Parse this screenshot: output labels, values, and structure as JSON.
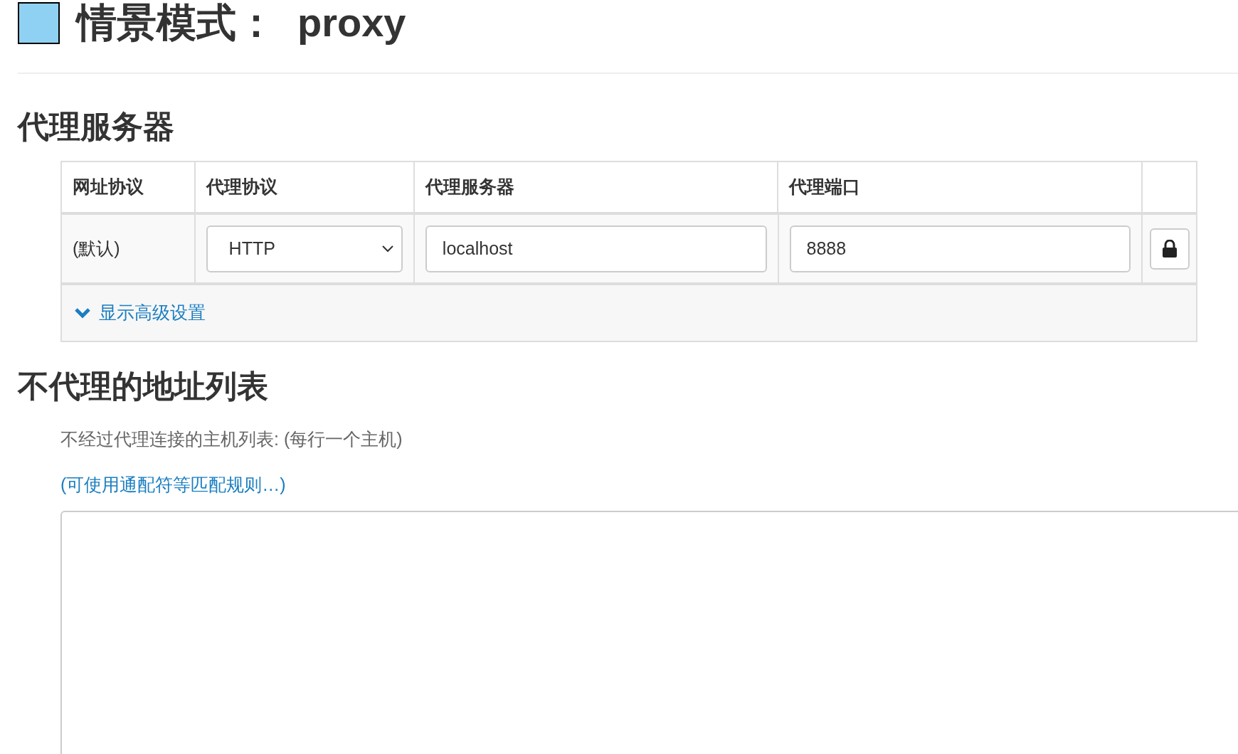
{
  "profile": {
    "color": "#8fd1f3",
    "title": "情景模式：",
    "name": "proxy"
  },
  "proxy_servers": {
    "heading": "代理服务器",
    "columns": [
      "网址协议",
      "代理协议",
      "代理服务器",
      "代理端口"
    ],
    "rows": [
      {
        "scheme": "(默认)",
        "protocol": "HTTP",
        "server": "localhost",
        "port": "8888"
      }
    ],
    "advanced_link": "显示高级设置"
  },
  "bypass": {
    "heading": "不代理的地址列表",
    "description": "不经过代理连接的主机列表: (每行一个主机)",
    "help_link": "(可使用通配符等匹配规则…)"
  }
}
